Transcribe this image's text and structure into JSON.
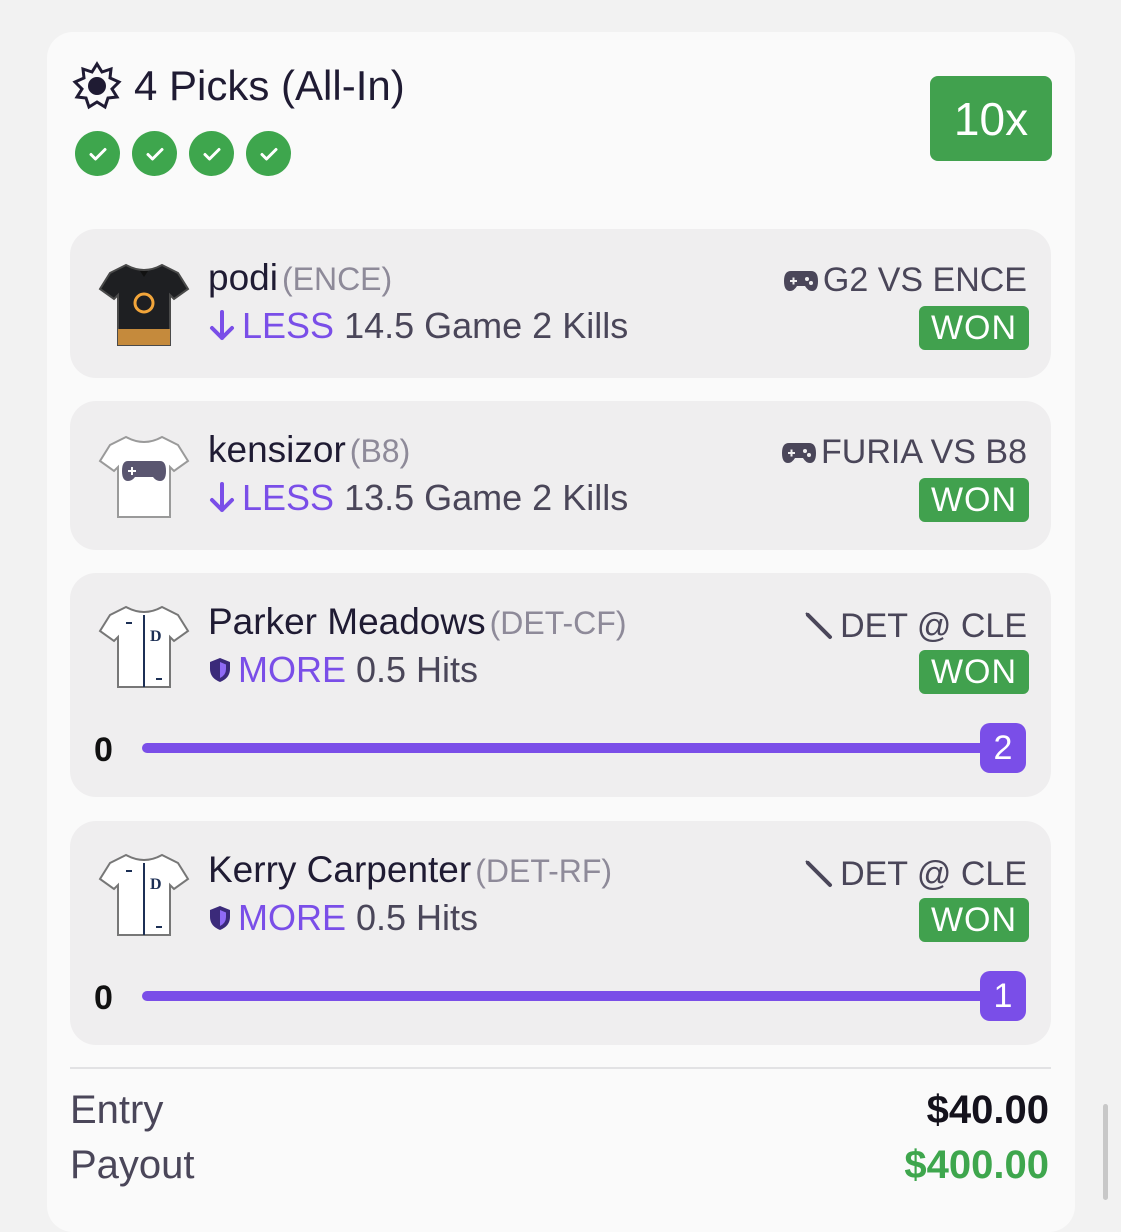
{
  "header": {
    "title": "4 Picks (All-In)",
    "multiplier": "10x",
    "checks": 4
  },
  "colors": {
    "accent": "#7a4ee8",
    "won": "#41a14e",
    "payout": "#3ea64d"
  },
  "picks": [
    {
      "player": "podi",
      "team": "(ENCE)",
      "direction": "LESS",
      "line": "14.5",
      "stat": "Game 2 Kills",
      "matchup": "G2 VS ENCE",
      "matchup_icon": "gamepad-icon",
      "status": "WON"
    },
    {
      "player": "kensizor",
      "team": "(B8)",
      "direction": "LESS",
      "line": "13.5",
      "stat": "Game 2 Kills",
      "matchup": "FURIA VS B8",
      "matchup_icon": "gamepad-icon",
      "status": "WON"
    },
    {
      "player": "Parker Meadows",
      "team": "(DET-CF)",
      "direction": "MORE",
      "line": "0.5",
      "stat": "Hits",
      "matchup": "DET @ CLE",
      "matchup_icon": "baseball-bat-icon",
      "status": "WON",
      "progress": {
        "start": "0",
        "value": "2"
      }
    },
    {
      "player": "Kerry Carpenter",
      "team": "(DET-RF)",
      "direction": "MORE",
      "line": "0.5",
      "stat": "Hits",
      "matchup": "DET @ CLE",
      "matchup_icon": "baseball-bat-icon",
      "status": "WON",
      "progress": {
        "start": "0",
        "value": "1"
      }
    }
  ],
  "summary": {
    "entry_label": "Entry",
    "entry_value": "$40.00",
    "payout_label": "Payout",
    "payout_value": "$400.00"
  }
}
